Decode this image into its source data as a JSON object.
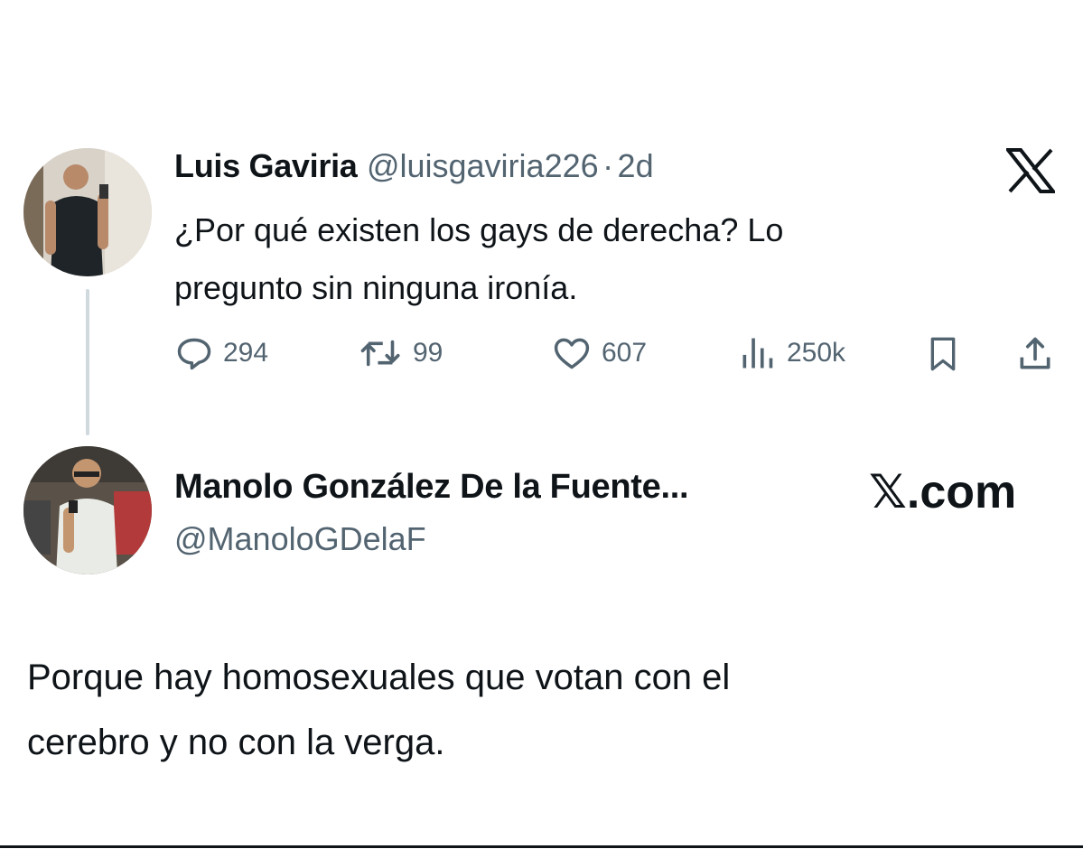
{
  "tweet": {
    "author_name": "Luis Gaviria",
    "handle": "@luisgaviria226",
    "separator": "·",
    "time": "2d",
    "text_line1": "¿Por qué existen los gays de derecha? Lo",
    "text_line2": "pregunto sin ninguna ironía.",
    "actions": {
      "replies": "294",
      "reposts": "99",
      "likes": "607",
      "views": "250k"
    },
    "icons": [
      "reply-icon",
      "repost-icon",
      "like-icon",
      "views-icon",
      "bookmark-icon",
      "share-icon",
      "x-logo-icon"
    ]
  },
  "reply": {
    "author_name": "Manolo González De la Fuente...",
    "handle": "@ManoloGDelaF",
    "brand": "𝕏.com",
    "text_line1": "Porque hay homosexuales que votan con el",
    "text_line2": "cerebro y no con la verga."
  },
  "colors": {
    "text": "#0f1419",
    "secondary": "#536471",
    "thread_line": "#cfd9de"
  }
}
